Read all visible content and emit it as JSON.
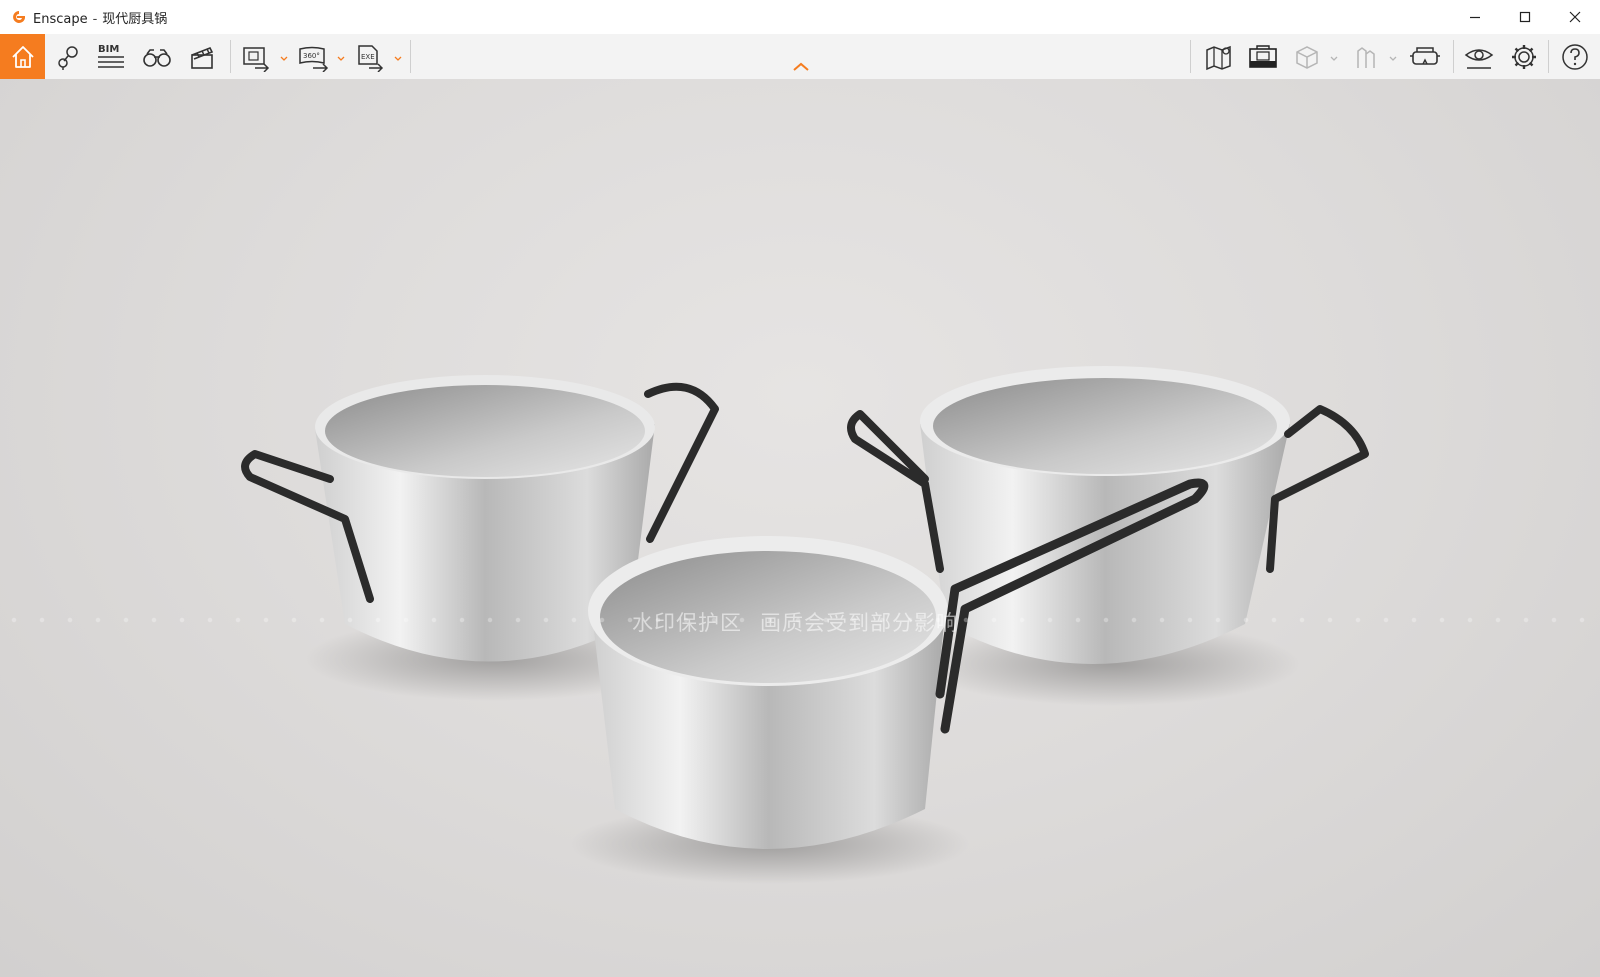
{
  "window": {
    "app_name": "Enscape",
    "separator": "-",
    "document_name": "现代厨具锅",
    "controls": [
      "minimize-icon",
      "maximize-icon",
      "close-icon"
    ]
  },
  "toolbar": {
    "bim_label": "BIM",
    "pano_label": "360°",
    "exe_label": "EXE",
    "accent_color": "#f57c1f",
    "left_tools": [
      "home-icon",
      "location-icon",
      "bim-icon",
      "binoculars-icon",
      "clapperboard-icon",
      "screenshot-export-icon",
      "panorama-export-icon",
      "exe-export-icon"
    ],
    "right_tools": [
      "map-icon",
      "asset-library-icon",
      "cube-icon",
      "walk-icon",
      "vr-headset-icon",
      "visual-settings-icon",
      "settings-gear-icon",
      "help-icon"
    ]
  },
  "viewport": {
    "watermark_left": "水印保护区",
    "watermark_right": "画质会受到部分影响",
    "background_color": "#dddbda"
  }
}
